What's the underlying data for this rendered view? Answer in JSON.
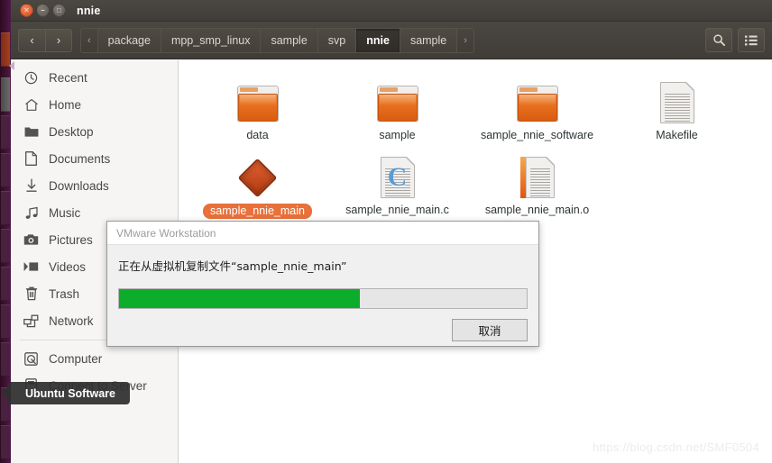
{
  "window": {
    "title": "nnie",
    "controls": [
      {
        "name": "close",
        "glyph": "✕"
      },
      {
        "name": "minimize",
        "glyph": "−"
      },
      {
        "name": "maximize",
        "glyph": "□"
      }
    ]
  },
  "toolbar": {
    "back_label": "‹",
    "forward_label": "›",
    "crumb_prev_label": "‹",
    "crumb_next_label": "›",
    "breadcrumbs": [
      {
        "label": "package",
        "active": false
      },
      {
        "label": "mpp_smp_linux",
        "active": false
      },
      {
        "label": "sample",
        "active": false
      },
      {
        "label": "svp",
        "active": false
      },
      {
        "label": "nnie",
        "active": true
      },
      {
        "label": "sample",
        "active": false
      }
    ],
    "search_icon": "search-icon",
    "view_icon": "list-view-icon"
  },
  "sidebar": {
    "items": [
      {
        "label": "Recent",
        "icon": "clock-icon"
      },
      {
        "label": "Home",
        "icon": "home-icon"
      },
      {
        "label": "Desktop",
        "icon": "folder-icon"
      },
      {
        "label": "Documents",
        "icon": "document-icon"
      },
      {
        "label": "Downloads",
        "icon": "download-icon"
      },
      {
        "label": "Music",
        "icon": "music-note-icon"
      },
      {
        "label": "Pictures",
        "icon": "camera-icon"
      },
      {
        "label": "Videos",
        "icon": "video-icon"
      },
      {
        "label": "Trash",
        "icon": "trash-icon"
      },
      {
        "label": "Network",
        "icon": "network-icon"
      }
    ],
    "items_lower": [
      {
        "label": "Computer",
        "icon": "computer-disk-icon"
      },
      {
        "label": "Connect to Server",
        "icon": "server-icon"
      }
    ]
  },
  "files": [
    {
      "name": "data",
      "type": "folder",
      "selected": false
    },
    {
      "name": "sample",
      "type": "folder",
      "selected": false
    },
    {
      "name": "sample_nnie_software",
      "type": "folder",
      "selected": false
    },
    {
      "name": "Makefile",
      "type": "document",
      "selected": false
    },
    {
      "name": "sample_nnie_main",
      "type": "executable",
      "selected": true
    },
    {
      "name": "sample_nnie_main.c",
      "type": "c-source",
      "selected": false
    },
    {
      "name": "sample_nnie_main.o",
      "type": "object-file",
      "selected": false
    }
  ],
  "dialog": {
    "title": "VMware Workstation",
    "message": "正在从虚拟机复制文件“sample_nnie_main”",
    "progress_percent": 59,
    "cancel_label": "取消"
  },
  "tooltip": {
    "label": "Ubuntu Software"
  },
  "watermark": {
    "text": "https://blog.csdn.net/SMF0504"
  },
  "colors": {
    "accent_orange": "#e8703a",
    "progress_green": "#0cad2a",
    "toolbar_dark": "#45423d",
    "launcher_purple": "#3c1230"
  }
}
